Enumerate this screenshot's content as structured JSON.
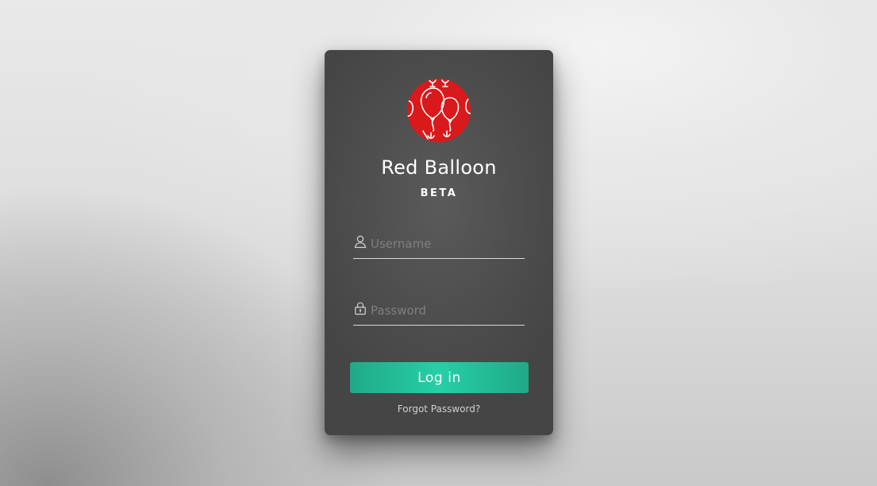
{
  "login_card": {
    "title": "Red Balloon",
    "subtitle": "BETA",
    "logo_icon": "red-balloons-logo",
    "username": {
      "placeholder": "Username",
      "value": "",
      "icon": "user-icon"
    },
    "password": {
      "placeholder": "Password",
      "value": "",
      "icon": "lock-icon"
    },
    "login_button_label": "Log in",
    "forgot_password_label": "Forgot Password?"
  },
  "colors": {
    "logo_red": "#d9191b",
    "button_accent": "#26cfa7",
    "card_background": "#4d4d4d"
  }
}
